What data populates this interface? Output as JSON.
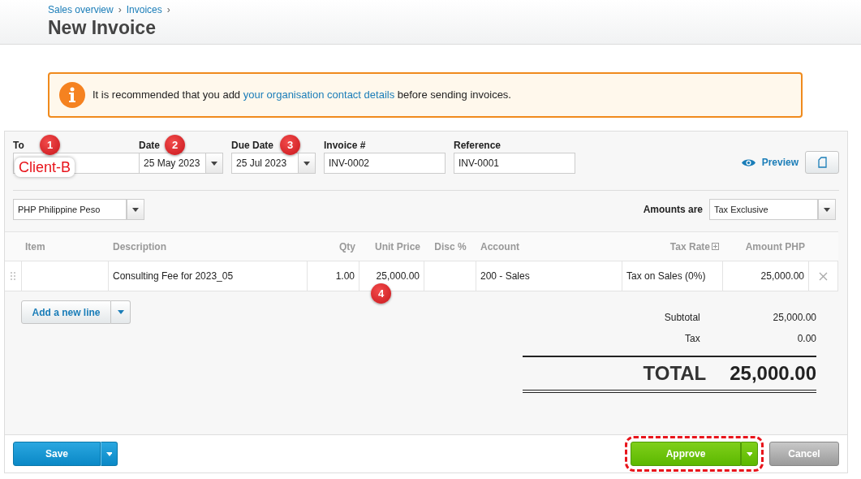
{
  "breadcrumb": {
    "separator": "›",
    "items": [
      {
        "label": "Sales overview"
      },
      {
        "label": "Invoices"
      }
    ]
  },
  "title": "New Invoice",
  "alert": {
    "before": "It is recommended that you add ",
    "link": "your organisation contact details",
    "after": " before sending invoices."
  },
  "fields": [
    {
      "label": "To",
      "kind": "text",
      "marker": "1",
      "callout": "Client-B"
    },
    {
      "label": "Date",
      "kind": "date",
      "value": "25 May 2023",
      "marker": "2"
    },
    {
      "label": "Due Date",
      "kind": "date",
      "value": "25 Jul 2023",
      "marker": "3"
    },
    {
      "label": "Invoice #",
      "kind": "text",
      "value": "INV-0002"
    },
    {
      "label": "Reference",
      "kind": "text",
      "value": "INV-0001"
    }
  ],
  "preview": "Preview",
  "currency": "PHP Philippine Peso",
  "amounts_are": {
    "label": "Amounts are",
    "value": "Tax Exclusive"
  },
  "columns": [
    {
      "label": "Item"
    },
    {
      "label": "Description"
    },
    {
      "label": "Qty"
    },
    {
      "label": "Unit Price"
    },
    {
      "label": "Disc %"
    },
    {
      "label": "Account"
    },
    {
      "label": "Tax Rate",
      "expandable": true
    },
    {
      "label": "Amount PHP"
    }
  ],
  "rows": [
    {
      "cells": [
        {},
        {
          "text": "Consulting Fee for 2023_05"
        },
        {
          "text": "1.00"
        },
        {
          "text": "25,000.00",
          "marker": "4"
        },
        {},
        {
          "text": "200 - Sales"
        },
        {
          "text": "Tax on Sales (0%)"
        },
        {
          "text": "25,000.00"
        }
      ]
    }
  ],
  "add_line": "Add a new line",
  "totals": [
    {
      "label": "Subtotal",
      "value": "25,000.00"
    },
    {
      "label": "Tax",
      "value": "0.00"
    }
  ],
  "total": {
    "label": "TOTAL",
    "value": "25,000.00"
  },
  "buttons": {
    "save": "Save",
    "approve": {
      "label": "Approve",
      "highlighted": true
    },
    "cancel": "Cancel"
  }
}
